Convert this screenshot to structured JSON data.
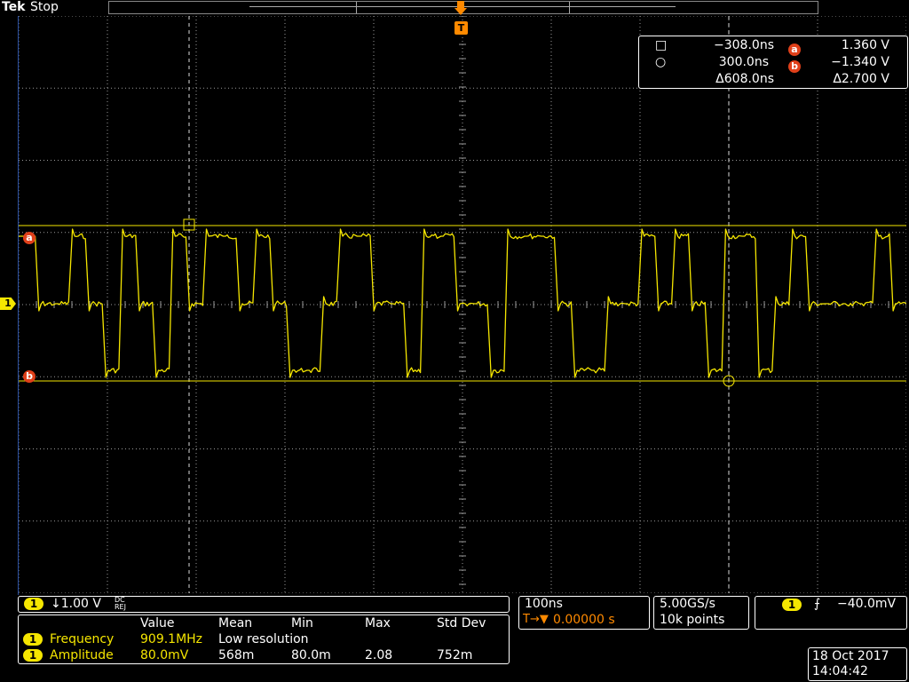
{
  "top": {
    "brand": "Tek",
    "status": "Stop",
    "trigger_marker": "T"
  },
  "cursors": {
    "row1": {
      "symbol": "□",
      "time": "−308.0ns",
      "badge": "a",
      "volt": "1.360 V"
    },
    "row2": {
      "symbol": "○",
      "time": "300.0ns",
      "badge": "b",
      "volt": "−1.340 V"
    },
    "row3": {
      "time": "Δ608.0ns",
      "volt": "Δ2.700 V"
    }
  },
  "markers": {
    "a": "a",
    "b": "b",
    "ch1": "1"
  },
  "channel": {
    "badge": "1",
    "scale": "↓1.00 V",
    "coupling_top": "DC",
    "coupling_bottom": "REJ"
  },
  "timebase": {
    "scale": "100ns",
    "position": "0.00000 s",
    "position_prefix": "T→▼"
  },
  "acq": {
    "rate": "5.00GS/s",
    "points": "10k points"
  },
  "trigger": {
    "badge": "1",
    "slope": "⨍",
    "level": "−40.0mV"
  },
  "measurements": {
    "headers": [
      "Value",
      "Mean",
      "Min",
      "Max",
      "Std Dev"
    ],
    "rows": [
      {
        "badge": "1",
        "name": "Frequency",
        "value": "909.1MHz",
        "mean": "Low resolution",
        "min": "",
        "max": "",
        "std": ""
      },
      {
        "badge": "1",
        "name": "Amplitude",
        "value": "80.0mV",
        "mean": "568m",
        "min": "80.0m",
        "max": "2.08",
        "std": "752m"
      }
    ]
  },
  "datetime": {
    "date": "18 Oct 2017",
    "time": "14:04:42"
  },
  "colors": {
    "trace": "#f5e600",
    "cursor": "#f5e600",
    "badge_orange": "#e0401a",
    "grid": "#9a9a9a"
  },
  "waveform": {
    "high_level": "1.360 V",
    "low_level": "−1.340 V",
    "bit_states": [
      2,
      1,
      1,
      2,
      1,
      0,
      2,
      1,
      0,
      2,
      1,
      2,
      2,
      1,
      2,
      1,
      0,
      0,
      1,
      2,
      2,
      1,
      1,
      0,
      2,
      2,
      1,
      1,
      0,
      2,
      2,
      2,
      1,
      0,
      0,
      1,
      1,
      2,
      1,
      2,
      1,
      0,
      2,
      2,
      0,
      1,
      2,
      1,
      1,
      1,
      1,
      2,
      1
    ]
  }
}
